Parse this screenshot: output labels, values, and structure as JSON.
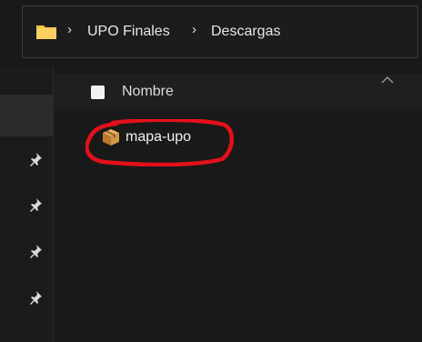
{
  "address_bar": {
    "breadcrumbs": [
      "UPO Finales",
      "Descargas"
    ],
    "icon": "folder-icon",
    "separator_icon": "chevron-right-icon"
  },
  "column_header": {
    "name_label": "Nombre",
    "sort_icon": "sort-ascending-icon"
  },
  "files": [
    {
      "name": "mapa-upo",
      "icon": "archive-box-icon"
    }
  ],
  "navigation_pane": {
    "pinned_icons": [
      "pin-icon",
      "pin-icon",
      "pin-icon",
      "pin-icon"
    ]
  },
  "annotation": {
    "type": "red-freehand-circle",
    "color": "#e3101a"
  },
  "colors": {
    "background": "#191919",
    "text": "#e6e6e6",
    "folder": "#f5c342"
  }
}
